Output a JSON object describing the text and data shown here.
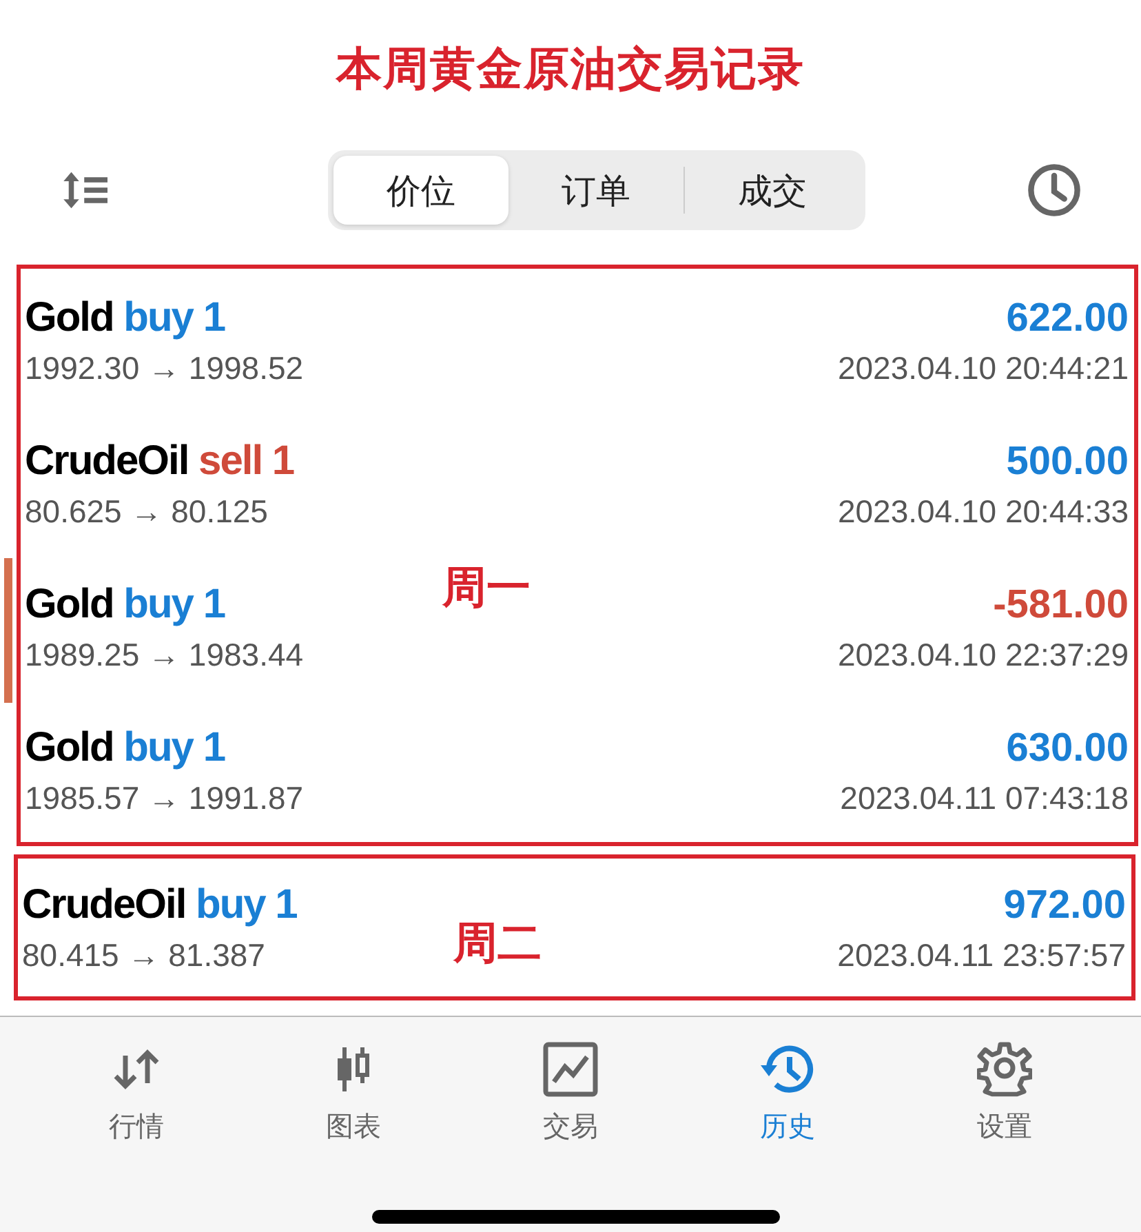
{
  "title": "本周黄金原油交易记录",
  "tabs": [
    {
      "label": "价位",
      "selected": true
    },
    {
      "label": "订单",
      "selected": false
    },
    {
      "label": "成交",
      "selected": false
    }
  ],
  "groups": [
    {
      "label": "周一",
      "trades": [
        {
          "symbol": "Gold",
          "side": "buy 1",
          "kind": "buy",
          "prices": "1992.30 → 1998.52",
          "profit": {
            "text": "622.00",
            "kind": "gain"
          },
          "time": "2023.04.10 20:44:21"
        },
        {
          "symbol": "CrudeOil",
          "side": "sell 1",
          "kind": "sell",
          "prices": "80.625 → 80.125",
          "profit": {
            "text": "500.00",
            "kind": "gain"
          },
          "time": "2023.04.10 20:44:33"
        },
        {
          "symbol": "Gold",
          "side": "buy 1",
          "kind": "buy",
          "prices": "1989.25 → 1983.44",
          "profit": {
            "text": "-581.00",
            "kind": "loss"
          },
          "time": "2023.04.10 22:37:29"
        },
        {
          "symbol": "Gold",
          "side": "buy 1",
          "kind": "buy",
          "prices": "1985.57 → 1991.87",
          "profit": {
            "text": "630.00",
            "kind": "gain"
          },
          "time": "2023.04.11 07:43:18"
        }
      ]
    },
    {
      "label": "周二",
      "trades": [
        {
          "symbol": "CrudeOil",
          "side": "buy 1",
          "kind": "buy",
          "prices": "80.415 → 81.387",
          "profit": {
            "text": "972.00",
            "kind": "gain"
          },
          "time": "2023.04.11 23:57:57"
        }
      ]
    }
  ],
  "nav": [
    {
      "label": "行情",
      "kind": "quotes",
      "selected": false
    },
    {
      "label": "图表",
      "kind": "chart",
      "selected": false
    },
    {
      "label": "交易",
      "kind": "trade",
      "selected": false
    },
    {
      "label": "历史",
      "kind": "history",
      "selected": true
    },
    {
      "label": "设置",
      "kind": "settings",
      "selected": false
    }
  ]
}
